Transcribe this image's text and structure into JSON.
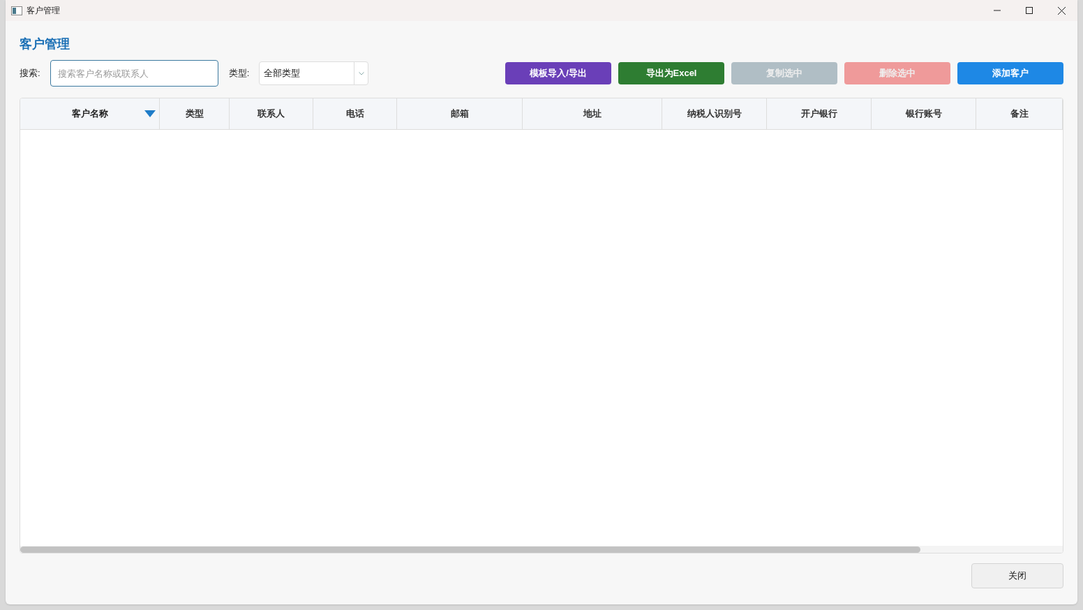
{
  "window": {
    "title": "客户管理"
  },
  "heading": "客户管理",
  "search": {
    "label": "搜索:",
    "placeholder": "搜索客户名称或联系人"
  },
  "type_filter": {
    "label": "类型:",
    "value": "全部类型"
  },
  "buttons": [
    {
      "label": "模板导入/导出",
      "color": "#6a3fb8",
      "disabled": false
    },
    {
      "label": "导出为Excel",
      "color": "#2e7d32",
      "disabled": false
    },
    {
      "label": "复制选中",
      "color": "#b0bec5",
      "disabled": true
    },
    {
      "label": "删除选中",
      "color": "#ef9a9a",
      "disabled": true
    },
    {
      "label": "添加客户",
      "color": "#1e88e5",
      "disabled": false
    }
  ],
  "table": {
    "columns": [
      {
        "label": "客户名称",
        "sorted": true
      },
      {
        "label": "类型",
        "sorted": false
      },
      {
        "label": "联系人",
        "sorted": false
      },
      {
        "label": "电话",
        "sorted": false
      },
      {
        "label": "邮箱",
        "sorted": false
      },
      {
        "label": "地址",
        "sorted": false
      },
      {
        "label": "纳税人识别号",
        "sorted": false
      },
      {
        "label": "开户银行",
        "sorted": false
      },
      {
        "label": "银行账号",
        "sorted": false
      },
      {
        "label": "备注",
        "sorted": false
      }
    ]
  },
  "footer_button": "关闭"
}
